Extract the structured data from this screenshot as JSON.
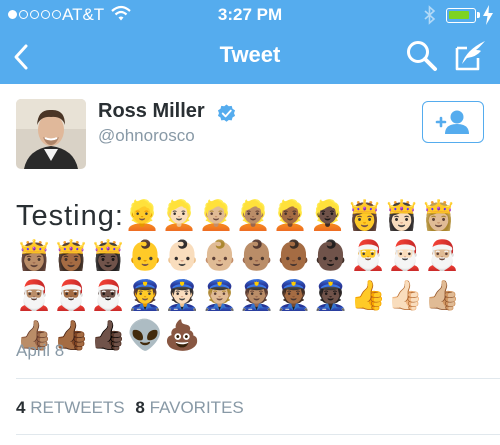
{
  "status_bar": {
    "carrier": "AT&T",
    "time": "3:27 PM",
    "signal_bars": 1,
    "signal_total": 5,
    "battery_level": 0.85
  },
  "nav": {
    "title": "Tweet",
    "icons": [
      "back-icon",
      "search-icon",
      "compose-icon"
    ]
  },
  "tweet": {
    "author_name": "Ross Miller",
    "author_handle": "@ohnorosco",
    "text": "Testing:👱👱🏻👱🏼👱🏽👱🏾👱🏿👸👸🏻👸🏼👸🏽👸🏾👸🏿👶👶🏻👶🏼👶🏽👶🏾👶🏿🎅🎅🏻🎅🏼🎅🏽🎅🏾🎅🏿👮👮🏻👮🏼👮🏽👮🏾👮🏿👍👍🏻👍🏼👍🏽👍🏾👍🏿👽💩",
    "date": "April 8",
    "retweets_count": "4",
    "retweets_label": "RETWEETS",
    "favorites_count": "8",
    "favorites_label": "FAVORITES"
  },
  "colors": {
    "accent": "#55acee",
    "text": "#292f33",
    "muted": "#8899a6",
    "divider": "#e1e8ed",
    "battery": "#7ed321"
  }
}
